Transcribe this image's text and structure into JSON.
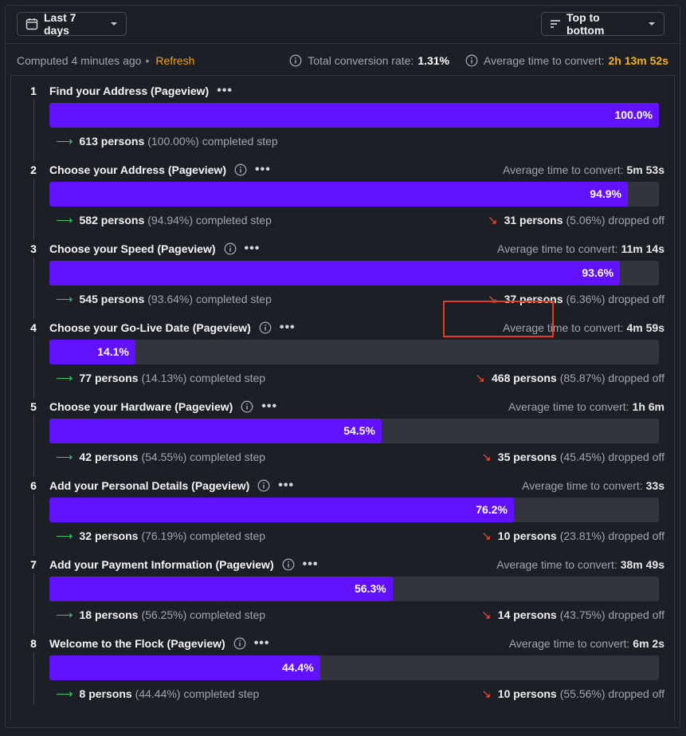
{
  "toolbar": {
    "date_label": "Last 7 days",
    "sort_label": "Top to bottom"
  },
  "status": {
    "computed": "Computed 4 minutes ago",
    "refresh": "Refresh",
    "total_label": "Total conversion rate:",
    "total_value": "1.31%",
    "avg_label": "Average time to convert:",
    "avg_value": "2h 13m 52s"
  },
  "steps": [
    {
      "num": "1",
      "name": "Find your Address (Pageview)",
      "avg_label": "",
      "avg_value": "",
      "pct": "100.0%",
      "fill": 100.0,
      "completed_count": "613 persons",
      "completed_pct": "(100.00%) completed step",
      "dropped_count": "",
      "dropped_pct": ""
    },
    {
      "num": "2",
      "name": "Choose your Address (Pageview)",
      "avg_label": "Average time to convert:",
      "avg_value": "5m 53s",
      "pct": "94.9%",
      "fill": 94.9,
      "completed_count": "582 persons",
      "completed_pct": "(94.94%) completed step",
      "dropped_count": "31 persons",
      "dropped_pct": "(5.06%) dropped off"
    },
    {
      "num": "3",
      "name": "Choose your Speed (Pageview)",
      "avg_label": "Average time to convert:",
      "avg_value": "11m 14s",
      "pct": "93.6%",
      "fill": 93.6,
      "completed_count": "545 persons",
      "completed_pct": "(93.64%) completed step",
      "dropped_count": "37 persons",
      "dropped_pct": "(6.36%) dropped off"
    },
    {
      "num": "4",
      "name": "Choose your Go-Live Date (Pageview)",
      "avg_label": "Average time to convert:",
      "avg_value": "4m 59s",
      "pct": "14.1%",
      "fill": 14.1,
      "completed_count": "77 persons",
      "completed_pct": "(14.13%) completed step",
      "dropped_count": "468 persons",
      "dropped_pct": "(85.87%) dropped off"
    },
    {
      "num": "5",
      "name": "Choose your Hardware (Pageview)",
      "avg_label": "Average time to convert:",
      "avg_value": "1h 6m",
      "pct": "54.5%",
      "fill": 54.5,
      "completed_count": "42 persons",
      "completed_pct": "(54.55%) completed step",
      "dropped_count": "35 persons",
      "dropped_pct": "(45.45%) dropped off"
    },
    {
      "num": "6",
      "name": "Add your Personal Details (Pageview)",
      "avg_label": "Average time to convert:",
      "avg_value": "33s",
      "pct": "76.2%",
      "fill": 76.2,
      "completed_count": "32 persons",
      "completed_pct": "(76.19%) completed step",
      "dropped_count": "10 persons",
      "dropped_pct": "(23.81%) dropped off"
    },
    {
      "num": "7",
      "name": "Add your Payment Information (Pageview)",
      "avg_label": "Average time to convert:",
      "avg_value": "38m 49s",
      "pct": "56.3%",
      "fill": 56.3,
      "completed_count": "18 persons",
      "completed_pct": "(56.25%) completed step",
      "dropped_count": "14 persons",
      "dropped_pct": "(43.75%) dropped off"
    },
    {
      "num": "8",
      "name": "Welcome to the Flock (Pageview)",
      "avg_label": "Average time to convert:",
      "avg_value": "6m 2s",
      "pct": "44.4%",
      "fill": 44.4,
      "completed_count": "8 persons",
      "completed_pct": "(44.44%) completed step",
      "dropped_count": "10 persons",
      "dropped_pct": "(55.56%) dropped off"
    }
  ],
  "colors": {
    "bar_fill": "#6211ff",
    "bar_track": "#33353e",
    "accent_time": "#f2b01e",
    "completed_arrow": "#3ec46d",
    "dropped_arrow": "#f04d2a",
    "highlight": "#e43b22"
  },
  "icons": {
    "date_button": "calendar-icon",
    "sort_button": "sort-lines-icon",
    "dropdown": "chevron-down-icon",
    "info": "info-circle-icon",
    "more": "more-horizontal-icon",
    "completed": "arrow-right-icon",
    "dropped": "arrow-down-right-icon"
  }
}
